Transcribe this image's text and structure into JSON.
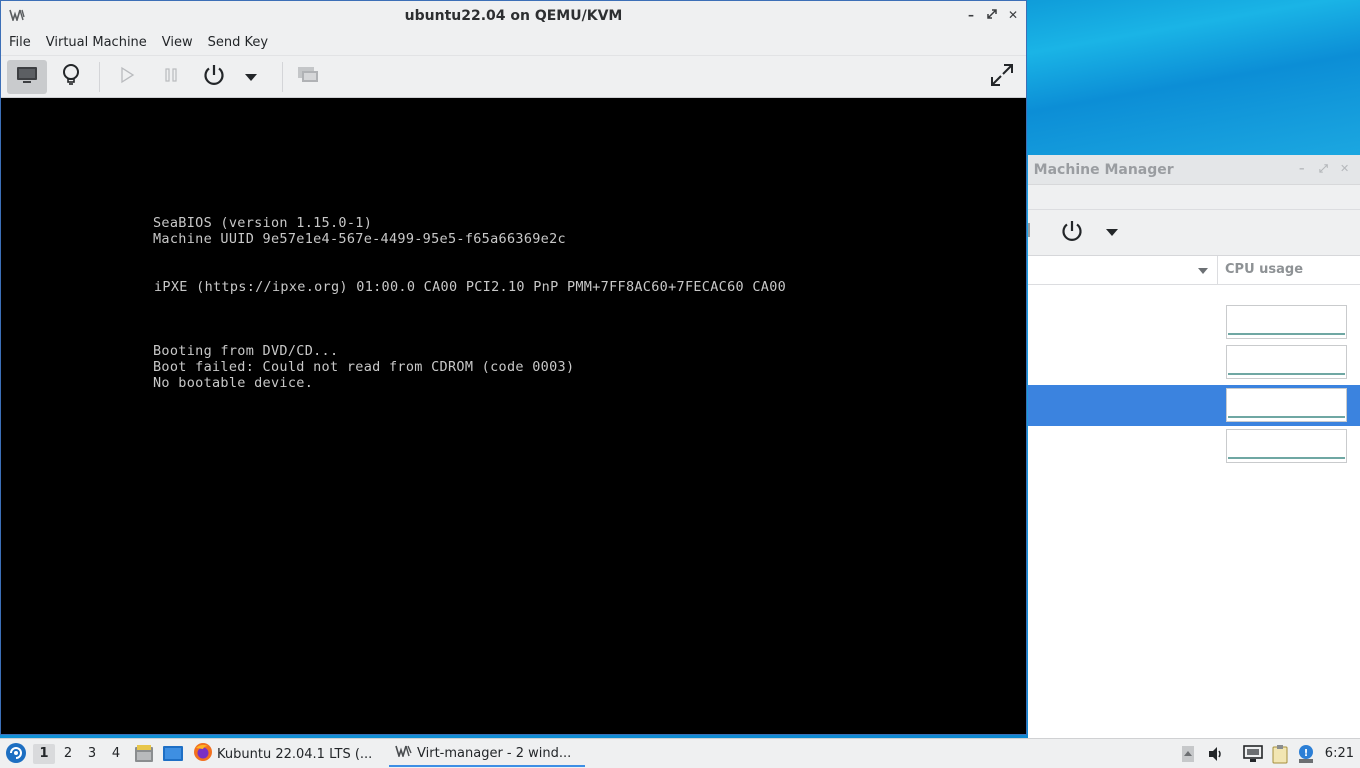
{
  "main_window": {
    "title": "ubuntu22.04 on QEMU/KVM",
    "menu": [
      "File",
      "Virtual Machine",
      "View",
      "Send Key"
    ],
    "toolbar": {
      "console_icon": "monitor-icon",
      "details_icon": "lightbulb-icon",
      "run_icon": "play-icon",
      "pause_icon": "pause-icon",
      "shutdown_icon": "power-icon",
      "shutdown_menu_icon": "chevron-down-icon",
      "snapshots_icon": "snapshot-icon",
      "fullscreen_icon": "fullscreen-icon"
    },
    "console_lines": [
      "SeaBIOS (version 1.15.0-1)",
      "Machine UUID 9e57e1e4-567e-4499-95e5-f65a66369e2c",
      "iPXE (https://ipxe.org) 01:00.0 CA00 PCI2.10 PnP PMM+7FF8AC60+7FECAC60 CA00",
      "Booting from DVD/CD...",
      "Boot failed: Could not read from CDROM (code 0003)",
      "No bootable device."
    ]
  },
  "background_window": {
    "title": "l Machine Manager",
    "column_cpu": "CPU usage",
    "selected_row_color": "#3b83df"
  },
  "taskbar": {
    "workspaces": [
      "1",
      "2",
      "3",
      "4"
    ],
    "active_workspace": "1",
    "tasks": [
      {
        "label": "Kubuntu 22.04.1 LTS (...",
        "icon": "firefox-icon"
      },
      {
        "label": "Virt-manager - 2 wind...",
        "icon": "virt-manager-icon"
      }
    ],
    "clock": "6:21"
  }
}
